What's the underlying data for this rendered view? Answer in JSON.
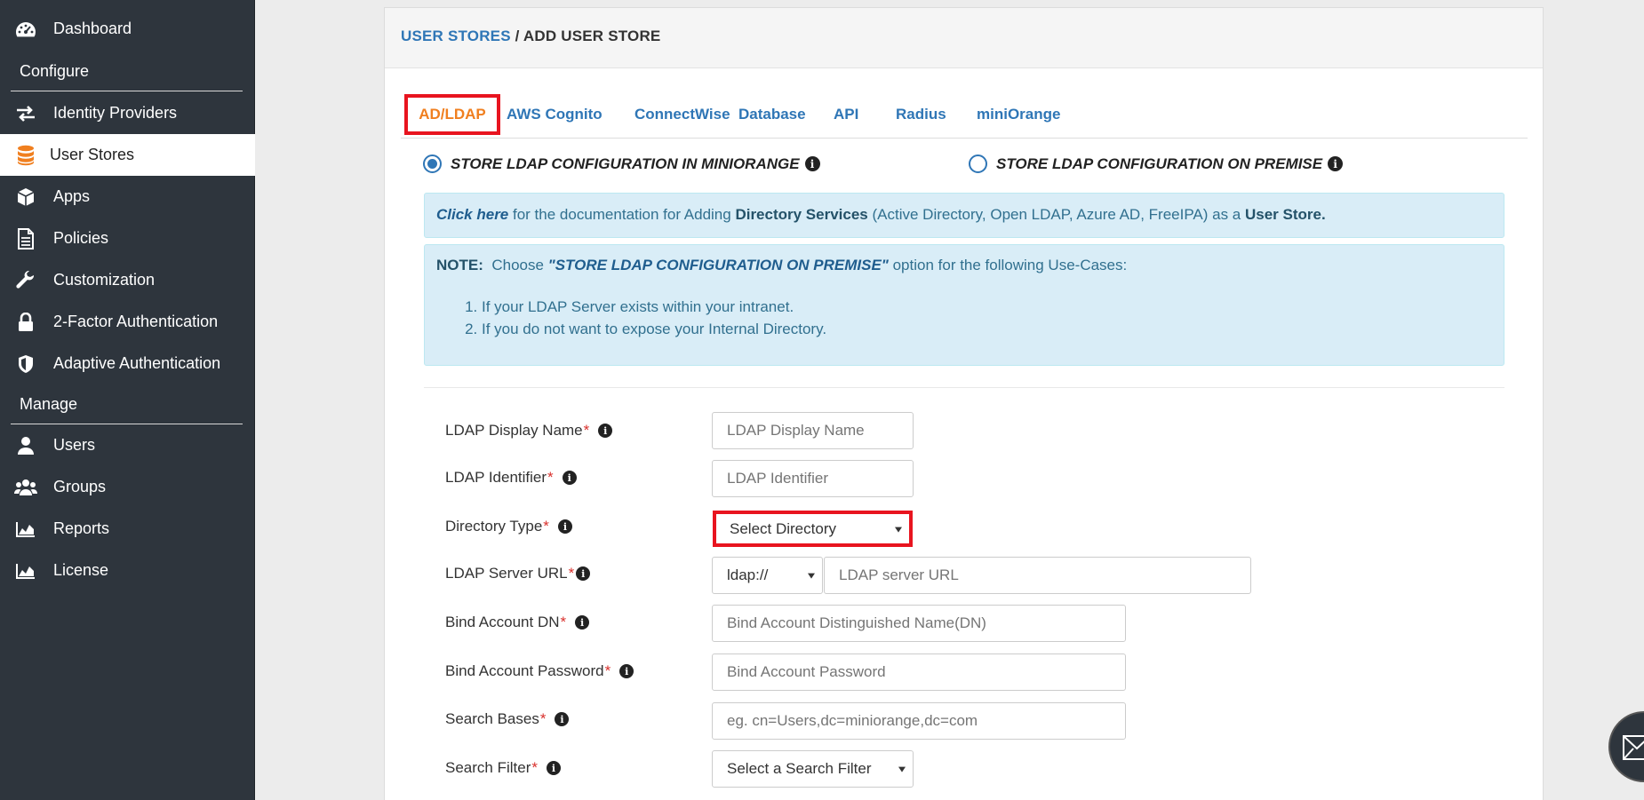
{
  "sidebar": {
    "items": [
      {
        "label": "Dashboard",
        "icon": "dashboard-icon"
      },
      {
        "label": "Identity Providers",
        "icon": "exchange-icon"
      },
      {
        "label": "User Stores",
        "icon": "database-icon",
        "active": true
      },
      {
        "label": "Apps",
        "icon": "cube-icon"
      },
      {
        "label": "Policies",
        "icon": "document-icon"
      },
      {
        "label": "Customization",
        "icon": "wrench-icon"
      },
      {
        "label": "2-Factor Authentication",
        "icon": "lock-icon"
      },
      {
        "label": "Adaptive Authentication",
        "icon": "shield-icon"
      },
      {
        "label": "Users",
        "icon": "user-icon"
      },
      {
        "label": "Groups",
        "icon": "users-icon"
      },
      {
        "label": "Reports",
        "icon": "area-chart-icon"
      },
      {
        "label": "License",
        "icon": "area-chart-icon"
      }
    ],
    "sections": {
      "configure": "Configure",
      "manage": "Manage"
    }
  },
  "breadcrumb": {
    "link": "USER STORES",
    "sep": " / ",
    "current": "ADD USER STORE"
  },
  "tabs": [
    "AD/LDAP",
    "AWS Cognito",
    "ConnectWise",
    "Database",
    "API",
    "Radius",
    "miniOrange"
  ],
  "radios": {
    "miniorange": "STORE LDAP CONFIGURATION IN MINIORANGE",
    "premise": "STORE LDAP CONFIGURATION ON PREMISE"
  },
  "doc_alert": {
    "click": "Click here",
    "t1": " for the documentation for Adding ",
    "b1": "Directory Services",
    "t2": " (Active Directory, Open LDAP, Azure AD, FreeIPA) as a ",
    "b2": "User Store."
  },
  "note_alert": {
    "label": "NOTE:",
    "t1": "  Choose ",
    "quote": "\"STORE LDAP CONFIGURATION ON PREMISE\"",
    "t2": " option for the following Use-Cases:",
    "items": [
      "If your LDAP Server exists within your intranet.",
      "If you do not want to expose your Internal Directory."
    ]
  },
  "form": {
    "display_name": {
      "label": "LDAP Display Name",
      "placeholder": "LDAP Display Name"
    },
    "identifier": {
      "label": "LDAP Identifier",
      "placeholder": "LDAP Identifier"
    },
    "directory_type": {
      "label": "Directory Type",
      "value": "Select Directory"
    },
    "server_url": {
      "label": "LDAP Server URL",
      "protocol": "ldap://",
      "placeholder": "LDAP server URL"
    },
    "bind_dn": {
      "label": "Bind Account DN",
      "placeholder": "Bind Account Distinguished Name(DN)"
    },
    "bind_password": {
      "label": "Bind Account Password",
      "placeholder": "Bind Account Password"
    },
    "search_bases": {
      "label": "Search Bases",
      "placeholder": "eg. cn=Users,dc=miniorange,dc=com"
    },
    "search_filter": {
      "label": "Search Filter",
      "value": "Select a Search Filter"
    },
    "required_mark": "*"
  },
  "colors": {
    "sidebar": "#2e353d",
    "link": "#2f76b6",
    "accent": "#f07f1f",
    "highlight": "#e8141f",
    "alert_bg": "#d9edf7"
  }
}
